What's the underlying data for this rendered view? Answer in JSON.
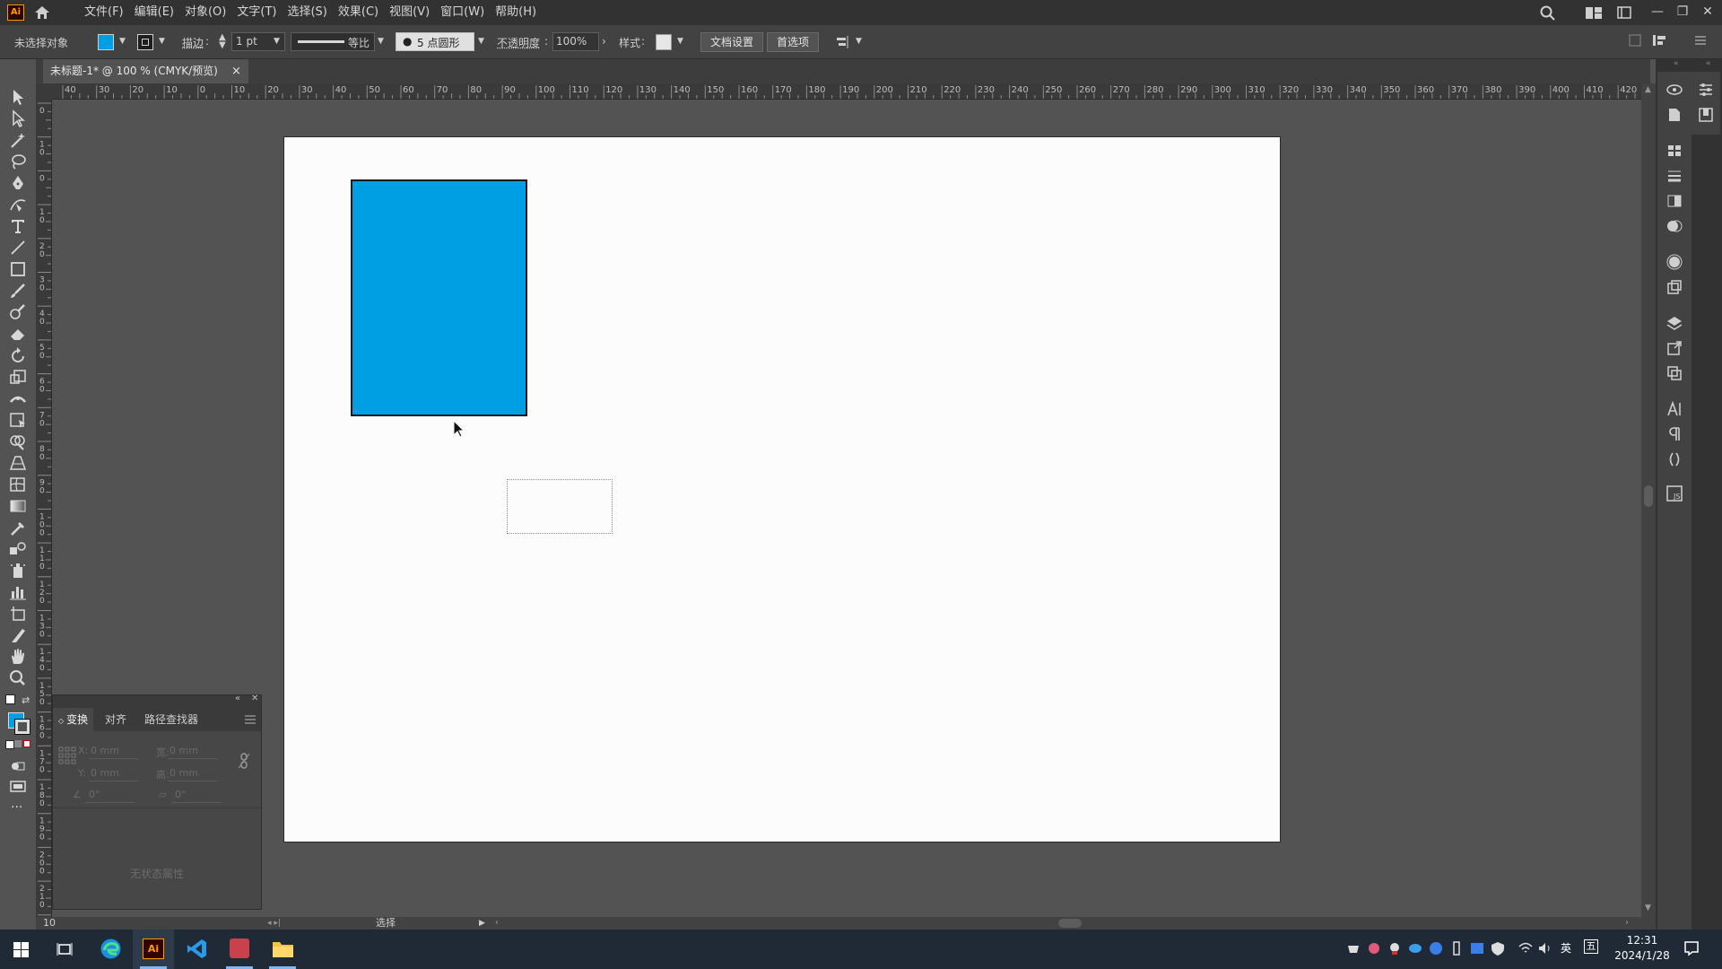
{
  "app": {
    "logo_text": "Ai",
    "menu": [
      "文件(F)",
      "编辑(E)",
      "对象(O)",
      "文字(T)",
      "选择(S)",
      "效果(C)",
      "视图(V)",
      "窗口(W)",
      "帮助(H)"
    ]
  },
  "control_bar": {
    "selection_status": "未选择对象",
    "fill_color": "#009ee3",
    "stroke_label": "描边",
    "stroke_weight": "1 pt",
    "profile_label": "等比",
    "brush_label": "5 点圆形",
    "opacity_label": "不透明度",
    "opacity_value": "100%",
    "style_label": "样式",
    "doc_setup_button": "文档设置",
    "preferences_button": "首选项"
  },
  "document": {
    "tab_title": "未标题-1* @ 100 % (CMYK/预览)",
    "close_glyph": "×"
  },
  "rulers": {
    "horizontal_ticks": [
      "40",
      "30",
      "20",
      "10",
      "0",
      "10",
      "20",
      "30",
      "40",
      "50",
      "60",
      "70",
      "80",
      "90",
      "100",
      "110",
      "120",
      "130",
      "140",
      "150",
      "160",
      "170",
      "180",
      "190",
      "200",
      "210",
      "220",
      "230",
      "240",
      "250",
      "260",
      "270",
      "280",
      "290",
      "300",
      "310",
      "320",
      "330",
      "340",
      "350",
      "360",
      "370",
      "380",
      "390",
      "400",
      "410",
      "420"
    ],
    "vertical_ticks": [
      "0",
      "10",
      "0",
      "10",
      "20",
      "30",
      "40",
      "50",
      "60",
      "70",
      "80",
      "90",
      "100",
      "110",
      "120",
      "130",
      "140",
      "150",
      "160",
      "170",
      "180",
      "190",
      "200",
      "210",
      "220",
      "230"
    ]
  },
  "artwork": {
    "rectangle_fill": "#009ee3",
    "artboard_color": "#fcfcfc"
  },
  "transform_panel": {
    "tabs": [
      "变换",
      "对齐",
      "路径查找器"
    ],
    "x_label": "X:",
    "y_label": "Y:",
    "w_label": "宽:",
    "h_label": "高:",
    "x_value": "0 mm",
    "y_value": "0 mm",
    "w_value": "0 mm",
    "h_value": "0 mm",
    "angle_value": "0°",
    "shear_value": "0°",
    "no_properties": "无状态属性"
  },
  "status": {
    "zoom": "10",
    "current_tool": "选择"
  },
  "taskbar": {
    "time": "12:31",
    "date": "2024/1/28",
    "ime_lang": "英",
    "ime_mode": "五"
  }
}
